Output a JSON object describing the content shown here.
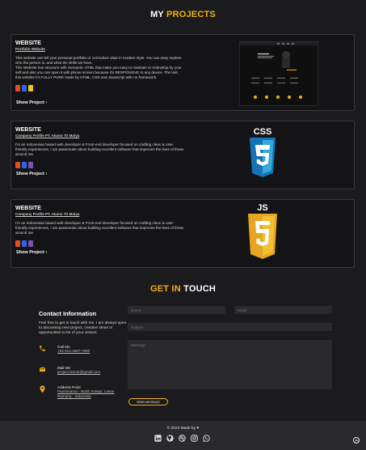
{
  "projects_section": {
    "title_a": "MY",
    "title_b": "PROJECTS"
  },
  "projects": [
    {
      "title": "WEBSITE",
      "subtitle": "Portfolio Website",
      "description": "This website can tell your personal portfolio or curriculum vitae in modern style. You can easy explore who the person is, and what the skills we have.\nThis Website has structure with Semantic HTML that make you easy to maintain or redevelop by your self and also you can open it with phone screen because it's RESPONSIVE to any device. The last, this website it's FULLY PURE made by HTML, CSS and Javascript with no framework.",
      "show_label": "Show Project",
      "tech": [
        "html5-icon",
        "css3-icon",
        "js-icon"
      ]
    },
    {
      "title": "WEBSITE",
      "subtitle": "Company Profile PT. Alumo Tri Mulya",
      "description": "I'm an Indonesian based web developer & Front-end developer focused on crafting clean & user-friendly experiences, I am passionate about building excellent software that improves the lives of those around me.",
      "show_label": "Show Project",
      "tech": [
        "html5-icon",
        "css3-icon",
        "bootstrap-icon"
      ],
      "badge": "CSS"
    },
    {
      "title": "WEBSITE",
      "subtitle": "Company Profile PT. Alumo Tri Mulya",
      "description": "I'm an Indonesian based web developer & Front-end developer focused on crafting clean & user-friendly experiences, I am passionate about building excellent software that improves the lives of those around me.",
      "show_label": "Show Project",
      "tech": [
        "html5-icon",
        "css3-icon",
        "bootstrap-icon"
      ],
      "badge": "JS"
    }
  ],
  "contact_section": {
    "title_a": "GET IN",
    "title_b": "TOUCH"
  },
  "contact": {
    "title": "Contact Information",
    "text": "Feel free to get in touch with me. I am always open to discussing new project, creative ideas or opportunities to be of your visions.",
    "call_label": "Call Me",
    "call_value": "+62 812-4567-7890",
    "mail_label": "Mail Me",
    "mail_value": "project.semut@gmail.com",
    "address_label": "Address Point",
    "address_value": "Panmmama - North Sulegs, Lassa Ramurry - Indonesia"
  },
  "form": {
    "name_placeholder": "Name",
    "email_placeholder": "Email",
    "subject_placeholder": "Subject",
    "message_placeholder": "Message",
    "submit_label": "SEND MESSAGE"
  },
  "footer": {
    "copyright": "© 2023 Made by ♥",
    "socials": [
      "linkedin-icon",
      "github-icon",
      "dribbble-icon",
      "instagram-icon",
      "whatsapp-icon"
    ]
  },
  "colors": {
    "accent": "#f2b11c",
    "background": "#1b1b1d",
    "card": "#141416"
  }
}
